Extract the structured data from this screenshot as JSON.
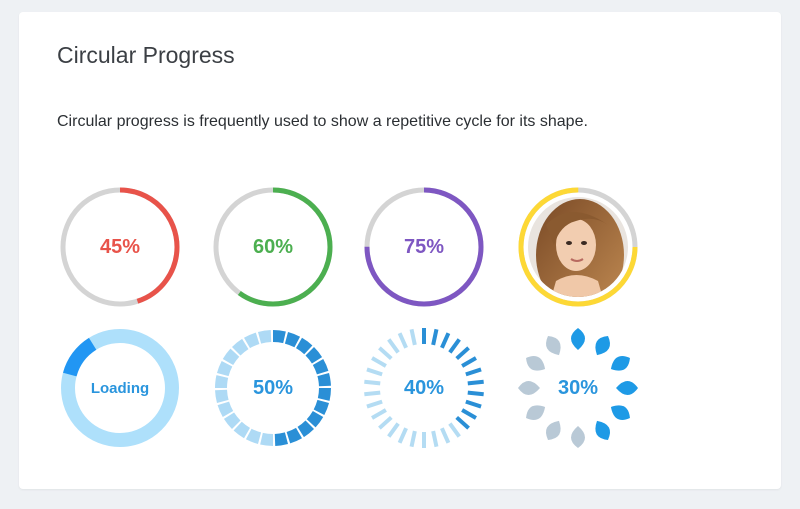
{
  "card": {
    "title": "Circular Progress",
    "description": "Circular progress is frequently used to show a repetitive cycle for its shape."
  },
  "row1": [
    {
      "label": "45%",
      "value": 0.45,
      "color": "#e8534a",
      "track": "#d4d4d4",
      "name": "progress-45-red"
    },
    {
      "label": "60%",
      "value": 0.6,
      "color": "#4caf50",
      "track": "#d4d4d4",
      "name": "progress-60-green"
    },
    {
      "label": "75%",
      "value": 0.75,
      "color": "#7e57c2",
      "track": "#d4d4d4",
      "name": "progress-75-purple"
    },
    {
      "value": 0.75,
      "color": "#fdd835",
      "track": "#d4d4d4",
      "name": "avatar-progress-yellow"
    }
  ],
  "row2": {
    "loading": {
      "label": "Loading",
      "color": "#2196f3",
      "track": "#aee0fb"
    },
    "segmented": {
      "label": "50%",
      "value": 0.5,
      "color": "#2a8fd6",
      "track": "#aedaf5"
    },
    "ticks": {
      "label": "40%",
      "value": 0.4,
      "color": "#2a8fd6",
      "track": "#b4dcf3"
    },
    "petals": {
      "label": "30%",
      "value": 0.3,
      "color": "#1e9ae6",
      "track": "#b9c9d6"
    }
  },
  "colors": {
    "label_blue": "#2a95dd"
  }
}
